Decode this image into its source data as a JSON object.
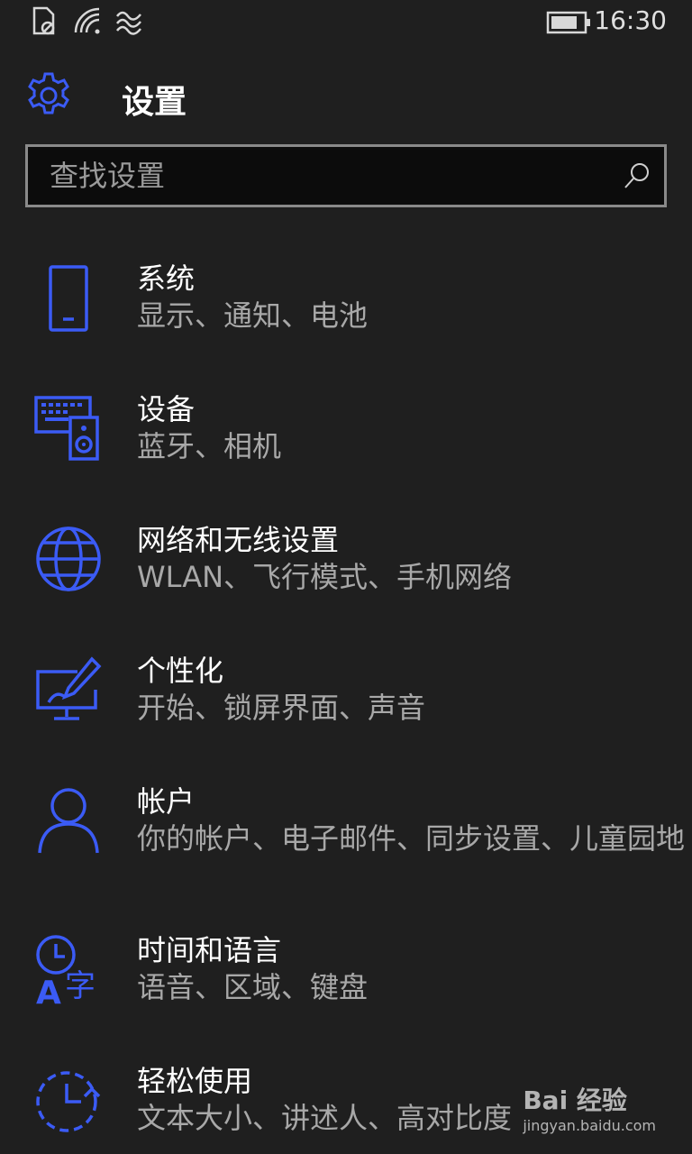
{
  "statusbar": {
    "time": "16:30"
  },
  "header": {
    "title": "设置"
  },
  "search": {
    "placeholder": "查找设置"
  },
  "items": [
    {
      "title": "系统",
      "subtitle": "显示、通知、电池",
      "icon": "phone-icon"
    },
    {
      "title": "设备",
      "subtitle": "蓝牙、相机",
      "icon": "devices-icon"
    },
    {
      "title": "网络和无线设置",
      "subtitle": "WLAN、飞行模式、手机网络",
      "icon": "globe-icon"
    },
    {
      "title": "个性化",
      "subtitle": "开始、锁屏界面、声音",
      "icon": "personalization-icon"
    },
    {
      "title": "帐户",
      "subtitle": "你的帐户、电子邮件、同步设置、儿童园地",
      "icon": "person-icon"
    },
    {
      "title": "时间和语言",
      "subtitle": "语音、区域、键盘",
      "icon": "time-language-icon"
    },
    {
      "title": "轻松使用",
      "subtitle": "文本大小、讲述人、高对比度",
      "icon": "ease-of-access-icon"
    }
  ],
  "watermark": {
    "brand": "Bai 经验",
    "url": "jingyan.baidu.com"
  },
  "colors": {
    "accent": "#3b5bf5",
    "background": "#1f1f1f",
    "subtitle": "#a8a8a8"
  }
}
